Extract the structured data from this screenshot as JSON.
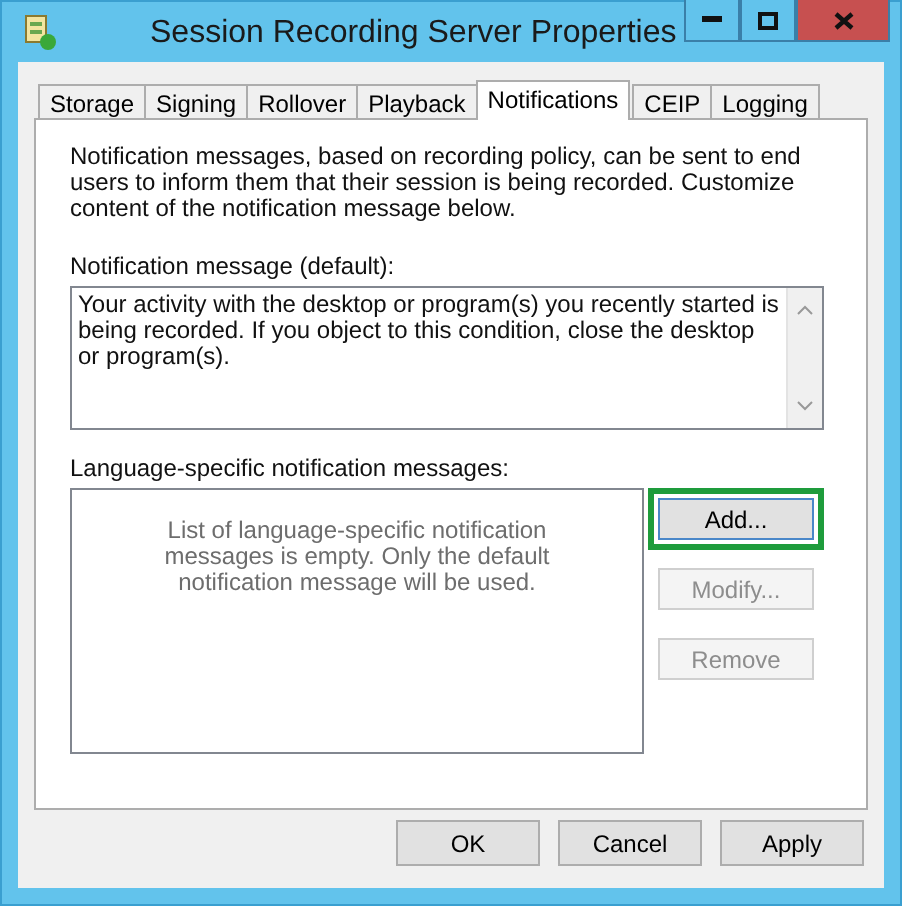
{
  "window": {
    "title": "Session Recording Server Properties"
  },
  "tabs": [
    {
      "label": "Storage",
      "selected": false
    },
    {
      "label": "Signing",
      "selected": false
    },
    {
      "label": "Rollover",
      "selected": false
    },
    {
      "label": "Playback",
      "selected": false
    },
    {
      "label": "Notifications",
      "selected": true
    },
    {
      "label": "CEIP",
      "selected": false
    },
    {
      "label": "Logging",
      "selected": false
    }
  ],
  "intro": "Notification messages, based on recording policy, can be sent to end users to inform them that their session is being recorded. Customize content of the notification message below.",
  "default_message": {
    "label": "Notification message (default):",
    "value": "Your activity with the desktop or program(s) you recently started is being recorded. If you object to this condition, close the desktop or program(s)."
  },
  "language_messages": {
    "label": "Language-specific notification messages:",
    "empty_text": "List of language-specific notification messages is empty. Only the default notification message will be used."
  },
  "side_buttons": [
    {
      "label": "Add...",
      "disabled": false,
      "highlighted": true
    },
    {
      "label": "Modify...",
      "disabled": true,
      "highlighted": false
    },
    {
      "label": "Remove",
      "disabled": true,
      "highlighted": false
    }
  ],
  "footer_buttons": [
    "OK",
    "Cancel",
    "Apply"
  ]
}
